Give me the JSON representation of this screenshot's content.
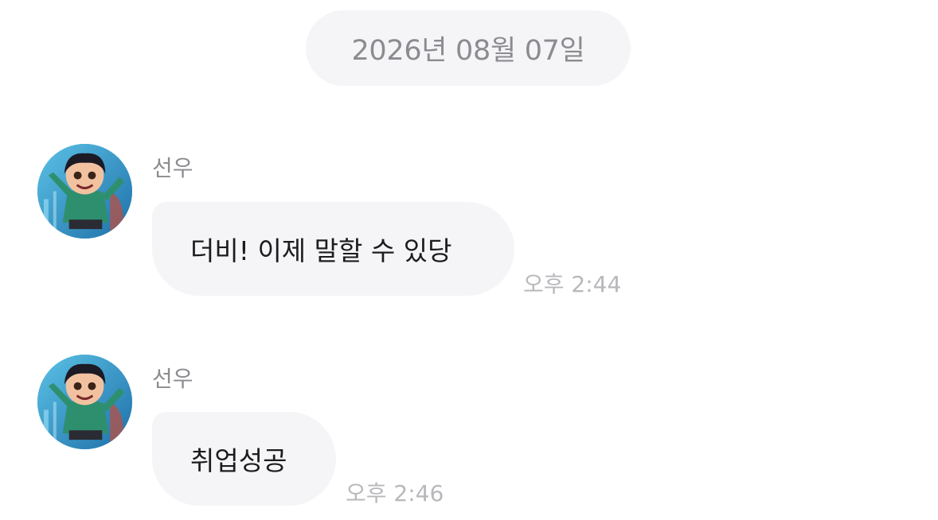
{
  "date_divider": "2026년 08월 07일",
  "messages": [
    {
      "sender": "선우",
      "text": "더비! 이제 말할 수 있당",
      "time": "오후 2:44",
      "avatar_icon": "girl-character-avatar"
    },
    {
      "sender": "선우",
      "text": "취업성공",
      "time": "오후 2:46",
      "avatar_icon": "girl-character-avatar"
    }
  ],
  "colors": {
    "background": "#ffffff",
    "bubble": "#f5f5f7",
    "date_text": "#8b8b90",
    "sender_text": "#8c8c90",
    "time_text": "#b8b8bc",
    "message_text": "#1c1c1e"
  }
}
